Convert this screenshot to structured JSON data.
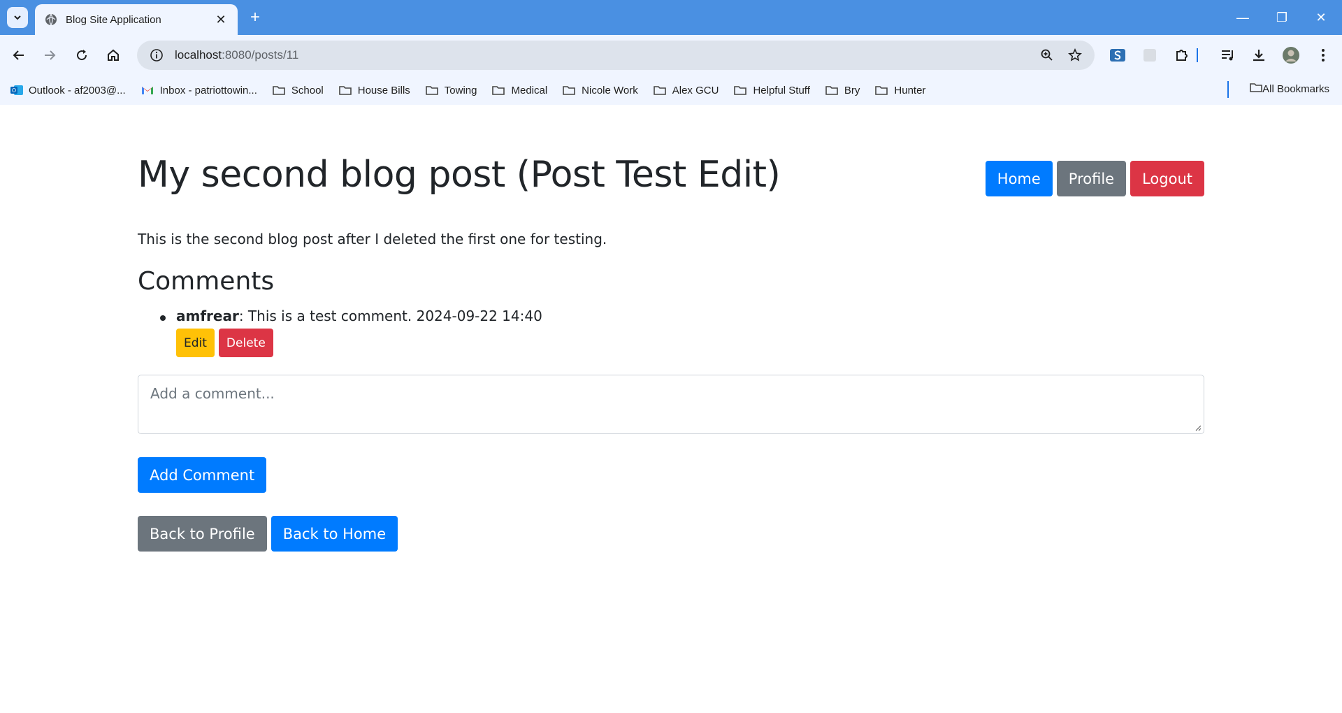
{
  "browser": {
    "tab_title": "Blog Site Application",
    "url_host": "localhost",
    "url_path": ":8080/posts/11",
    "bookmarks": [
      {
        "label": "Outlook - af2003@...",
        "icon": "outlook-icon"
      },
      {
        "label": "Inbox - patriottowin...",
        "icon": "gmail-icon"
      },
      {
        "label": "School",
        "icon": "folder-icon"
      },
      {
        "label": "House Bills",
        "icon": "folder-icon"
      },
      {
        "label": "Towing",
        "icon": "folder-icon"
      },
      {
        "label": "Medical",
        "icon": "folder-icon"
      },
      {
        "label": "Nicole Work",
        "icon": "folder-icon"
      },
      {
        "label": "Alex GCU",
        "icon": "folder-icon"
      },
      {
        "label": "Helpful Stuff",
        "icon": "folder-icon"
      },
      {
        "label": "Bry",
        "icon": "folder-icon"
      },
      {
        "label": "Hunter",
        "icon": "folder-icon"
      }
    ],
    "all_bookmarks": "All Bookmarks"
  },
  "post": {
    "title": "My second blog post (Post Test Edit)",
    "body": "This is the second blog post after I deleted the first one for testing."
  },
  "nav": {
    "home": "Home",
    "profile": "Profile",
    "logout": "Logout"
  },
  "comments": {
    "heading": "Comments",
    "items": [
      {
        "author": "amfrear",
        "text": ": This is a test comment. 2024-09-22 14:40",
        "edit_label": "Edit",
        "delete_label": "Delete"
      }
    ],
    "input_placeholder": "Add a comment...",
    "add_label": "Add Comment"
  },
  "footer_nav": {
    "back_profile": "Back to Profile",
    "back_home": "Back to Home"
  },
  "colors": {
    "primary": "#007bff",
    "secondary": "#6c757d",
    "danger": "#dc3545",
    "warning": "#ffc107",
    "chrome": "#4a90e2"
  }
}
